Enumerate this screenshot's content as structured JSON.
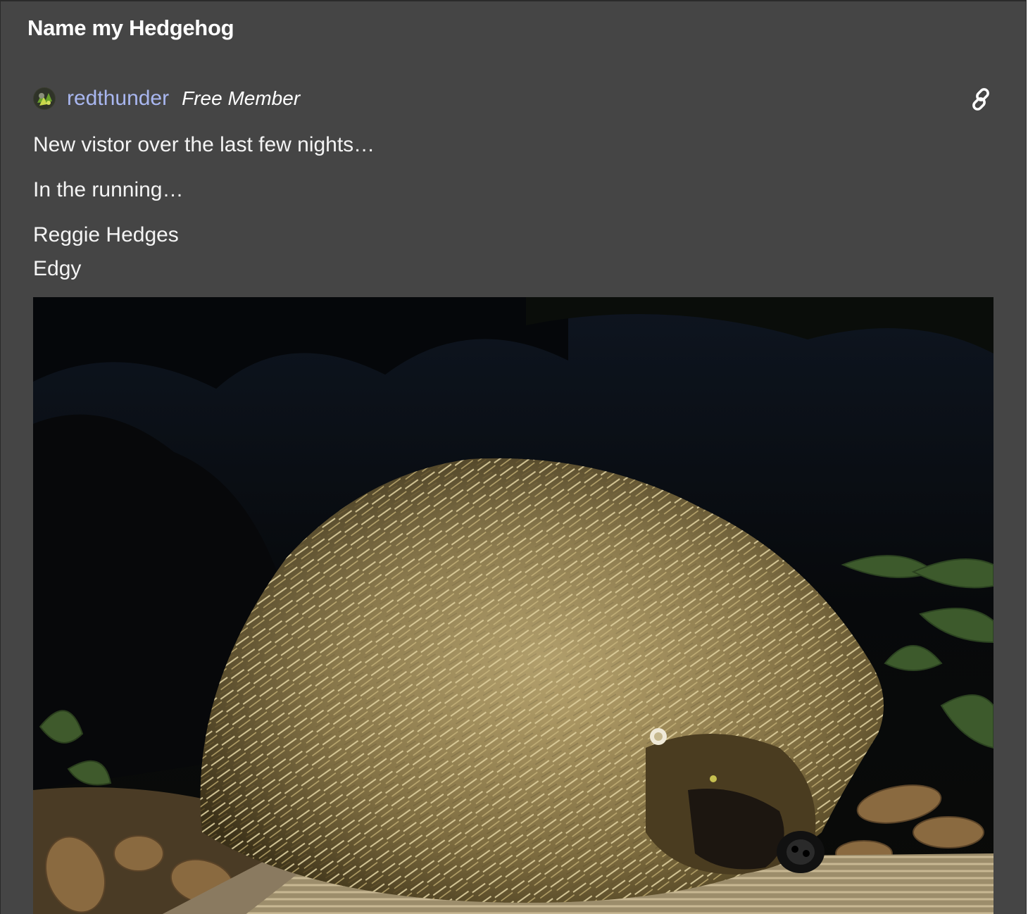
{
  "post": {
    "title": "Name my Hedgehog",
    "author": {
      "username": "redthunder",
      "member_type": "Free Member",
      "avatar_icon": "avatar-icon"
    },
    "permalink_icon": "link-icon",
    "body": {
      "paragraph1": "New vistor over the last few nights…",
      "paragraph2": "In the running…",
      "list_line1": "Reggie Hedges",
      "list_line2": "Edgy"
    },
    "image_alt": "hedgehog-photo"
  },
  "colors": {
    "background": "#454545",
    "username": "#a9b7f0",
    "text": "#f4f4f4"
  }
}
